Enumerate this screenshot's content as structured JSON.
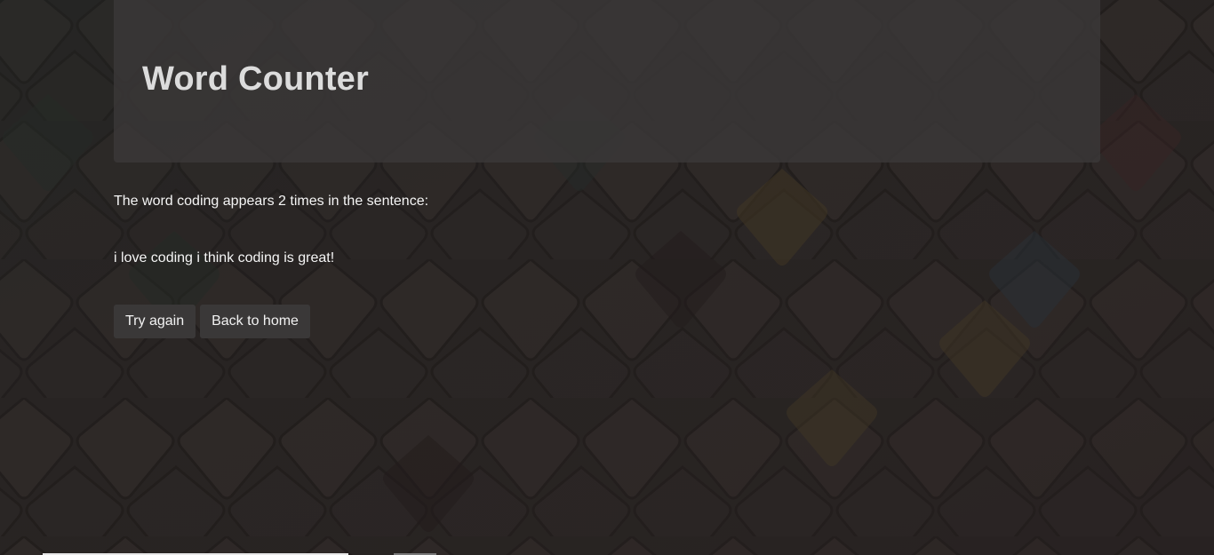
{
  "header": {
    "title": "Word Counter"
  },
  "result": {
    "prefix": "The word",
    "word": "coding",
    "middle": "appears",
    "count": "2",
    "suffix": "times in the sentence:",
    "sentence": "i love coding i think coding is great!"
  },
  "actions": {
    "try_again_label": "Try again",
    "back_home_label": "Back to home"
  },
  "colors": {
    "panel": "#3a3838",
    "button": "#3a3838",
    "text": "#f5f5f5",
    "title": "#dcdcdc"
  }
}
